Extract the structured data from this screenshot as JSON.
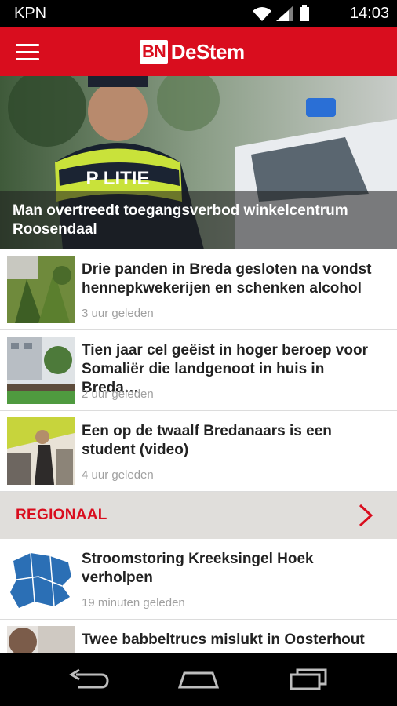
{
  "status": {
    "carrier": "KPN",
    "time": "14:03"
  },
  "appbar": {
    "logo_mark": "BN",
    "logo_name": "DeStem",
    "menu_icon": "hamburger-icon"
  },
  "hero": {
    "title": "Man overtreedt toegangsverbod winkelcentrum Roosendaal",
    "vest_text": "P LITIE"
  },
  "articles": [
    {
      "title": "Drie panden in Breda gesloten na vondst hennepkwekerijen en schenken alcohol",
      "time": "3 uur geleden"
    },
    {
      "title": "Tien jaar cel geëist in hoger beroep voor Somaliër die landgenoot in huis in Breda…",
      "time": "2 uur geleden"
    },
    {
      "title": "Een op de twaalf Bredanaars is een student (video)",
      "time": "4 uur geleden"
    }
  ],
  "section": {
    "label": "REGIONAAL",
    "icon": "chevron-right-icon"
  },
  "regional": [
    {
      "title": "Stroomstoring Kreeksingel Hoek verholpen",
      "time": "19 minuten geleden"
    },
    {
      "title": "Twee babbeltrucs mislukt in Oosterhout",
      "time": ""
    }
  ],
  "colors": {
    "brand": "#d90d1e",
    "section_bg": "#e0dedb",
    "muted": "#a0a0a0"
  }
}
